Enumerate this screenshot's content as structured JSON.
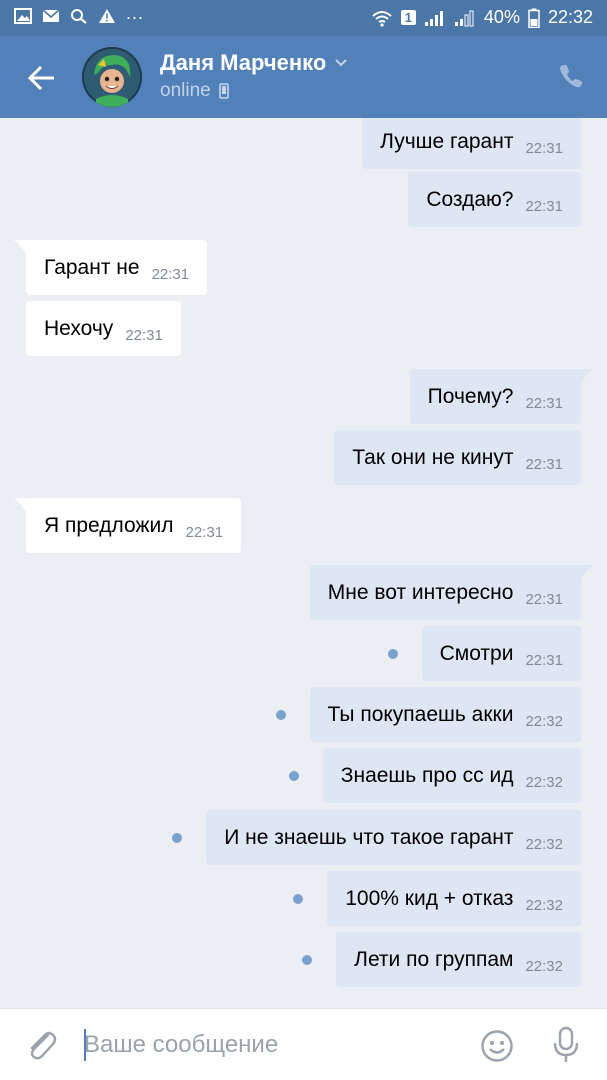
{
  "status_bar": {
    "battery": "40%",
    "time": "22:32",
    "sim_badge": "1",
    "dots": "..."
  },
  "header": {
    "contact_name": "Даня Марченко",
    "status": "online"
  },
  "messages": [
    {
      "dir": "out",
      "text": "Лучше гарант",
      "time": "22:31",
      "unread": false
    },
    {
      "dir": "out",
      "text": "Создаю?",
      "time": "22:31",
      "unread": false
    },
    {
      "dir": "in",
      "text": "Гарант не",
      "time": "22:31",
      "unread": false
    },
    {
      "dir": "in",
      "text": "Нехочу",
      "time": "22:31",
      "unread": false
    },
    {
      "dir": "out",
      "text": "Почему?",
      "time": "22:31",
      "unread": false
    },
    {
      "dir": "out",
      "text": "Так они не кинут",
      "time": "22:31",
      "unread": false
    },
    {
      "dir": "in",
      "text": "Я предложил",
      "time": "22:31",
      "unread": false
    },
    {
      "dir": "out",
      "text": "Мне вот интересно",
      "time": "22:31",
      "unread": false
    },
    {
      "dir": "out",
      "text": "Смотри",
      "time": "22:31",
      "unread": true
    },
    {
      "dir": "out",
      "text": "Ты покупаешь акки",
      "time": "22:32",
      "unread": true
    },
    {
      "dir": "out",
      "text": "Знаешь про сс ид",
      "time": "22:32",
      "unread": true
    },
    {
      "dir": "out",
      "text": "И не знаешь что такое гарант",
      "time": "22:32",
      "unread": true
    },
    {
      "dir": "out",
      "text": "100% кид + отказ",
      "time": "22:32",
      "unread": true
    },
    {
      "dir": "out",
      "text": "Лети по группам",
      "time": "22:32",
      "unread": true
    }
  ],
  "composer": {
    "placeholder": "Ваше сообщение"
  },
  "colors": {
    "header": "#5181b8",
    "status_bar": "#4a76a8",
    "background": "#ebeef2",
    "bubble_out": "#dde6f2",
    "bubble_in": "#ffffff",
    "unread_dot": "#7aa1cc"
  },
  "icons": [
    "back-arrow-icon",
    "chevron-down-icon",
    "mobile-device-icon",
    "phone-icon",
    "attach-icon",
    "emoji-icon",
    "microphone-icon"
  ]
}
